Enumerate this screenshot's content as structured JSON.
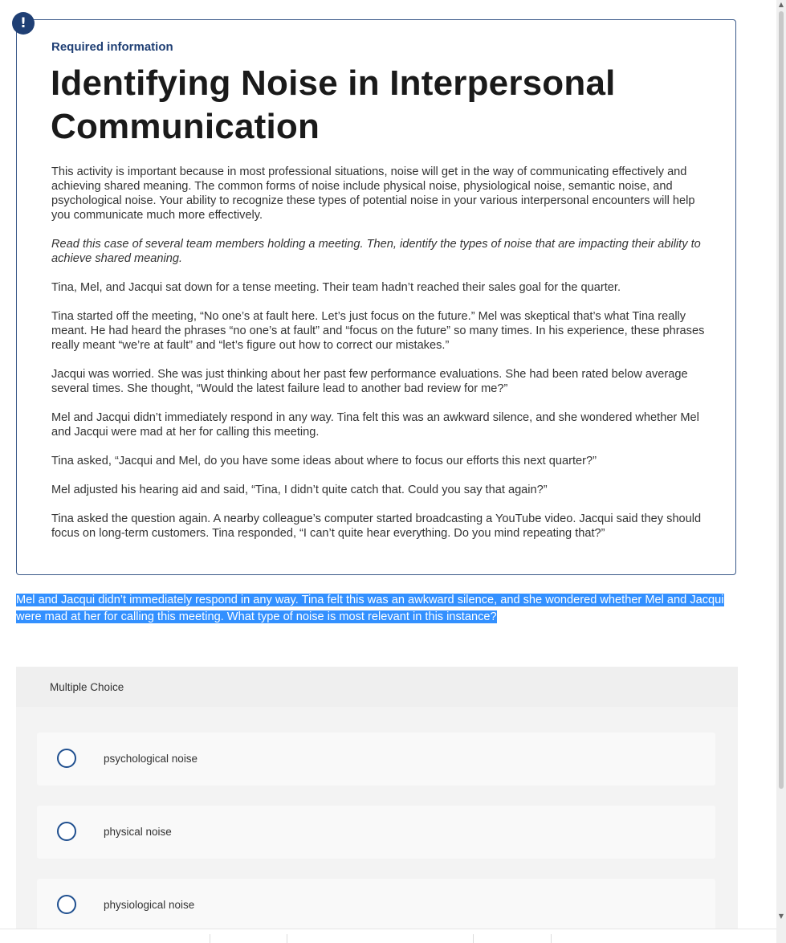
{
  "info": {
    "required_label": "Required information",
    "title": "Identifying Noise in Interpersonal Communication",
    "paragraphs": [
      "This activity is important because in most professional situations, noise will get in the way of communicating effectively and achieving shared meaning. The common forms of noise include physical noise, physiological noise, semantic noise, and psychological noise. Your ability to recognize these types of potential noise in your various interpersonal encounters will help you communicate much more effectively.",
      "Read this case of several team members holding a meeting. Then, identify the types of noise that are impacting their ability to achieve shared meaning.",
      "Tina, Mel, and Jacqui sat down for a tense meeting. Their team hadn’t reached their sales goal for the quarter.",
      "Tina started off the meeting, “No one’s at fault here. Let’s just focus on the future.” Mel was skeptical that’s what Tina really meant. He had heard the phrases “no one’s at fault” and “focus on the future” so many times. In his experience, these phrases really meant “we’re at fault” and “let’s figure out how to correct our mistakes.”",
      "Jacqui was worried. She was just thinking about her past few performance evaluations. She had been rated below average several times. She thought, “Would the latest failure lead to another bad review for me?”",
      "Mel and Jacqui didn’t immediately respond in any way. Tina felt this was an awkward silence, and she wondered whether Mel and Jacqui were mad at her for calling this meeting.",
      "Tina asked, “Jacqui and Mel, do you have some ideas about where to focus our efforts this next quarter?”",
      "Mel adjusted his hearing aid and said, “Tina, I didn’t quite catch that. Could you say that again?”",
      "Tina asked the question again. A nearby colleague’s computer started broadcasting a YouTube video. Jacqui said they should focus on long-term customers. Tina responded, “I can’t quite hear everything. Do you mind repeating that?”"
    ]
  },
  "question": {
    "text": "Mel and Jacqui didn’t immediately respond in any way. Tina felt this was an awkward silence, and she wondered whether Mel and Jacqui were mad at her for calling this meeting. What type of noise is most relevant in this instance?"
  },
  "multiple_choice": {
    "header": "Multiple Choice",
    "options": [
      {
        "label": "psychological noise"
      },
      {
        "label": "physical noise"
      },
      {
        "label": "physiological noise"
      }
    ]
  },
  "alert_icon": {
    "glyph": "!",
    "icon": "alert-icon"
  },
  "colors": {
    "accent": "#1f3f74",
    "highlight": "#3390ff",
    "radio_border": "#1f4f8f"
  }
}
